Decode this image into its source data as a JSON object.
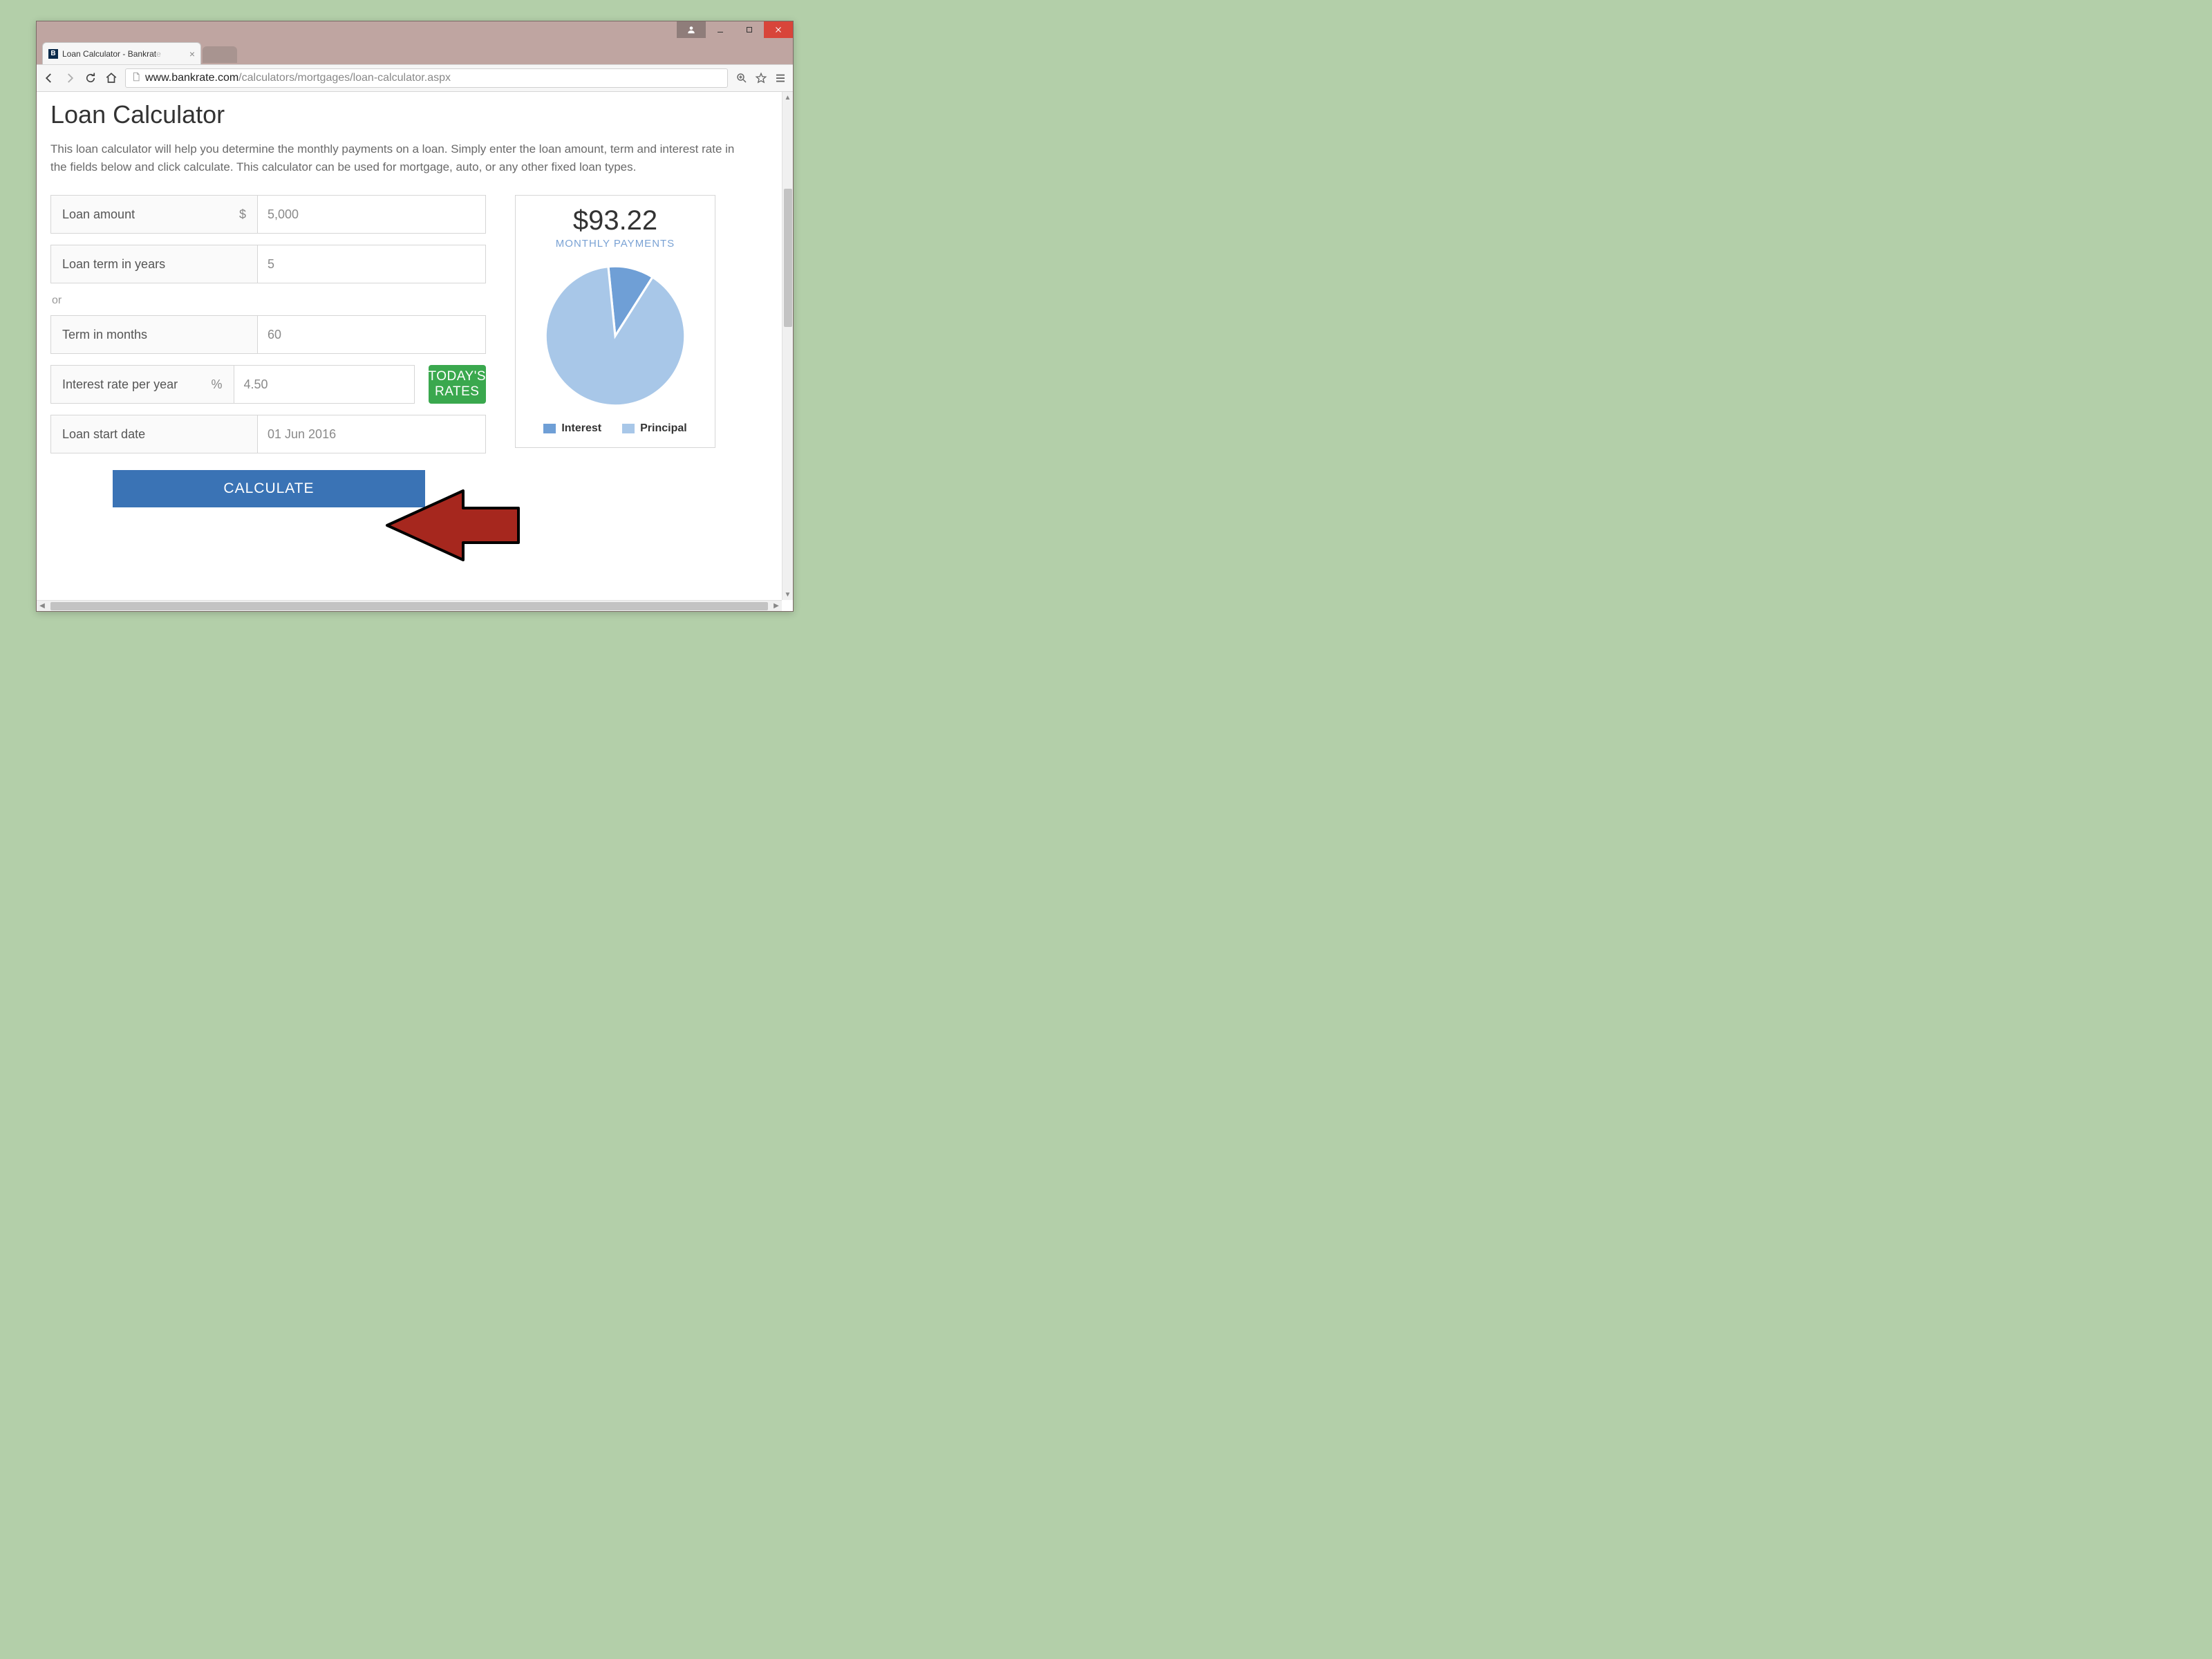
{
  "window": {
    "tab_title": "Loan Calculator - Bankrat",
    "tab_favicon_letter": "B",
    "url_host": "www.bankrate.com",
    "url_path": "/calculators/mortgages/loan-calculator.aspx"
  },
  "page": {
    "heading": "Loan Calculator",
    "intro": "This loan calculator will help you determine the monthly payments on a loan. Simply enter the loan amount, term and interest rate in the fields below and click calculate. This calculator can be used for mortgage, auto, or any other fixed loan types.",
    "fields": {
      "loan_amount": {
        "label": "Loan amount",
        "unit": "$",
        "value": "5,000"
      },
      "term_years": {
        "label": "Loan term in years",
        "value": "5"
      },
      "or_label": "or",
      "term_months": {
        "label": "Term in months",
        "value": "60"
      },
      "rate": {
        "label": "Interest rate per year",
        "unit": "%",
        "value": "4.50"
      },
      "todays_rates_label": "TODAY'S RATES",
      "start_date": {
        "label": "Loan start date",
        "value": "01 Jun 2016"
      },
      "calculate_label": "CALCULATE"
    },
    "result": {
      "value": "$93.22",
      "label": "MONTHLY PAYMENTS",
      "legend": {
        "interest": "Interest",
        "principal": "Principal"
      }
    }
  },
  "colors": {
    "principal": "#a8c7e8",
    "interest": "#6f9fd6",
    "accent_green": "#3aa84e",
    "accent_blue": "#3a73b5"
  },
  "chart_data": {
    "type": "pie",
    "title": "",
    "series": [
      {
        "name": "Interest",
        "value": 10.6,
        "color": "#6f9fd6"
      },
      {
        "name": "Principal",
        "value": 89.4,
        "color": "#a8c7e8"
      }
    ]
  }
}
